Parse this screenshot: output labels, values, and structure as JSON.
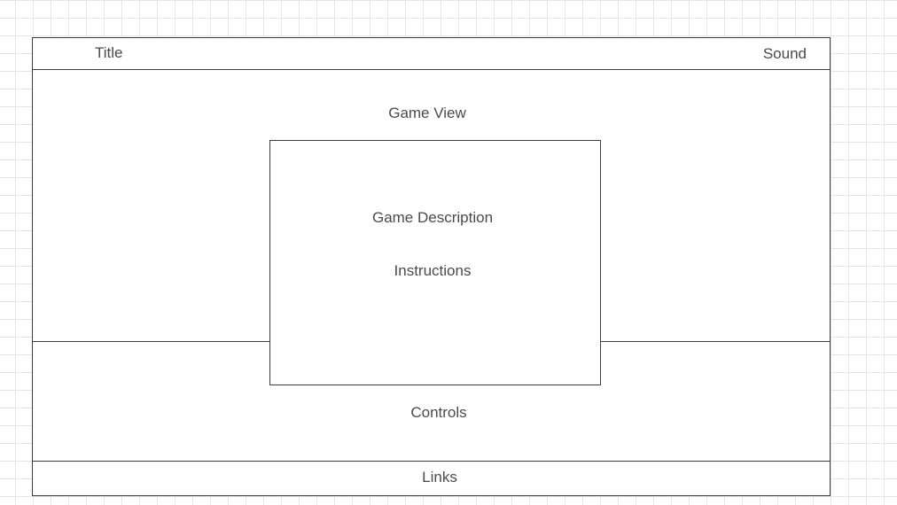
{
  "header": {
    "title": "Title",
    "sound": "Sound"
  },
  "game_view": {
    "label": "Game View"
  },
  "info_panel": {
    "description": "Game Description",
    "instructions": "Instructions"
  },
  "controls": {
    "label": "Controls"
  },
  "footer": {
    "links": "Links"
  }
}
